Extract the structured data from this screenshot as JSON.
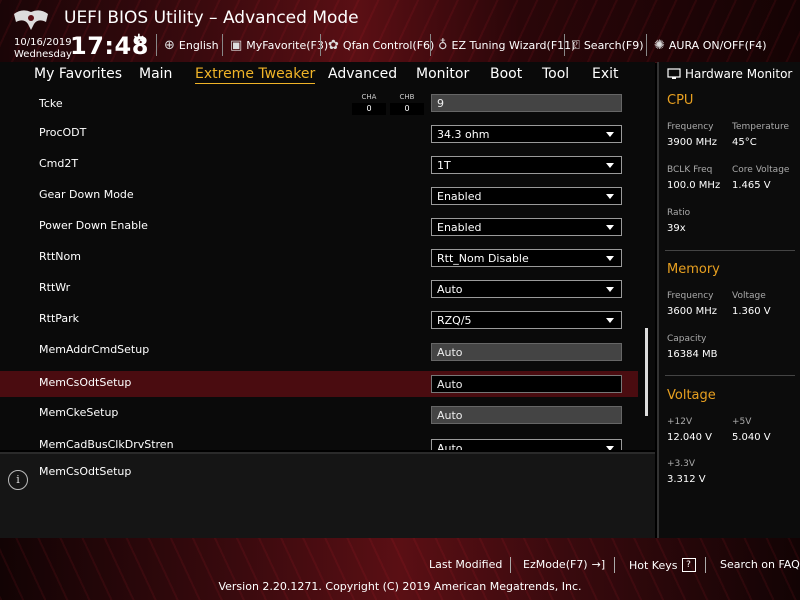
{
  "header": {
    "title": "UEFI BIOS Utility – Advanced Mode",
    "date": "10/16/2019",
    "weekday": "Wednesday",
    "time": "17:48",
    "tools": [
      {
        "label": "English",
        "icon": "globe-icon"
      },
      {
        "label": "MyFavorite(F3)",
        "icon": "favorite-icon"
      },
      {
        "label": "Qfan Control(F6)",
        "icon": "fan-icon"
      },
      {
        "label": "EZ Tuning Wizard(F11)",
        "icon": "bulb-icon"
      },
      {
        "label": "Search(F9)",
        "icon": "search-icon"
      },
      {
        "label": "AURA ON/OFF(F4)",
        "icon": "aura-icon"
      }
    ]
  },
  "menu": {
    "items": [
      "My Favorites",
      "Main",
      "Extreme Tweaker",
      "Advanced",
      "Monitor",
      "Boot",
      "Tool",
      "Exit"
    ],
    "active": "Extreme Tweaker"
  },
  "settings": {
    "tcke": {
      "label": "Tcke",
      "cha_label": "CHA",
      "cha_value": "0",
      "chb_label": "CHB",
      "chb_value": "0",
      "value": "9"
    },
    "rows": [
      {
        "label": "ProcODT",
        "value": "34.3 ohm",
        "type": "dropdown"
      },
      {
        "label": "Cmd2T",
        "value": "1T",
        "type": "dropdown"
      },
      {
        "label": "Gear Down Mode",
        "value": "Enabled",
        "type": "dropdown"
      },
      {
        "label": "Power Down Enable",
        "value": "Enabled",
        "type": "dropdown"
      },
      {
        "label": "RttNom",
        "value": "Rtt_Nom Disable",
        "type": "dropdown"
      },
      {
        "label": "RttWr",
        "value": "Auto",
        "type": "dropdown"
      },
      {
        "label": "RttPark",
        "value": "RZQ/5",
        "type": "dropdown"
      },
      {
        "label": "MemAddrCmdSetup",
        "value": "Auto",
        "type": "text"
      },
      {
        "label": "MemCsOdtSetup",
        "value": "Auto",
        "type": "text"
      },
      {
        "label": "MemCkeSetup",
        "value": "Auto",
        "type": "text"
      },
      {
        "label": "MemCadBusClkDrvStren",
        "value": "Auto",
        "type": "dropdown"
      }
    ],
    "selected_index": 8
  },
  "help": {
    "text": "MemCsOdtSetup",
    "icon": "info-icon"
  },
  "hardware_monitor": {
    "title": "Hardware Monitor",
    "cpu": {
      "section": "CPU",
      "frequency_label": "Frequency",
      "frequency": "3900 MHz",
      "temperature_label": "Temperature",
      "temperature": "45°C",
      "bclk_label": "BCLK Freq",
      "bclk": "100.0 MHz",
      "core_voltage_label": "Core Voltage",
      "core_voltage": "1.465 V",
      "ratio_label": "Ratio",
      "ratio": "39x"
    },
    "memory": {
      "section": "Memory",
      "frequency_label": "Frequency",
      "frequency": "3600 MHz",
      "voltage_label": "Voltage",
      "voltage": "1.360 V",
      "capacity_label": "Capacity",
      "capacity": "16384 MB"
    },
    "voltage": {
      "section": "Voltage",
      "v12_label": "+12V",
      "v12": "12.040 V",
      "v5_label": "+5V",
      "v5": "5.040 V",
      "v33_label": "+3.3V",
      "v33": "3.312 V"
    }
  },
  "footer": {
    "last_modified": "Last Modified",
    "ezmode": "EzMode(F7)",
    "hotkeys": "Hot Keys",
    "hotkeys_glyph": "?",
    "search_faq": "Search on FAQ",
    "version": "Version 2.20.1271. Copyright (C) 2019 American Megatrends, Inc."
  },
  "colors": {
    "accent": "#f0b428",
    "selected_row": "#4a0c10",
    "section_title": "#e8a020"
  }
}
